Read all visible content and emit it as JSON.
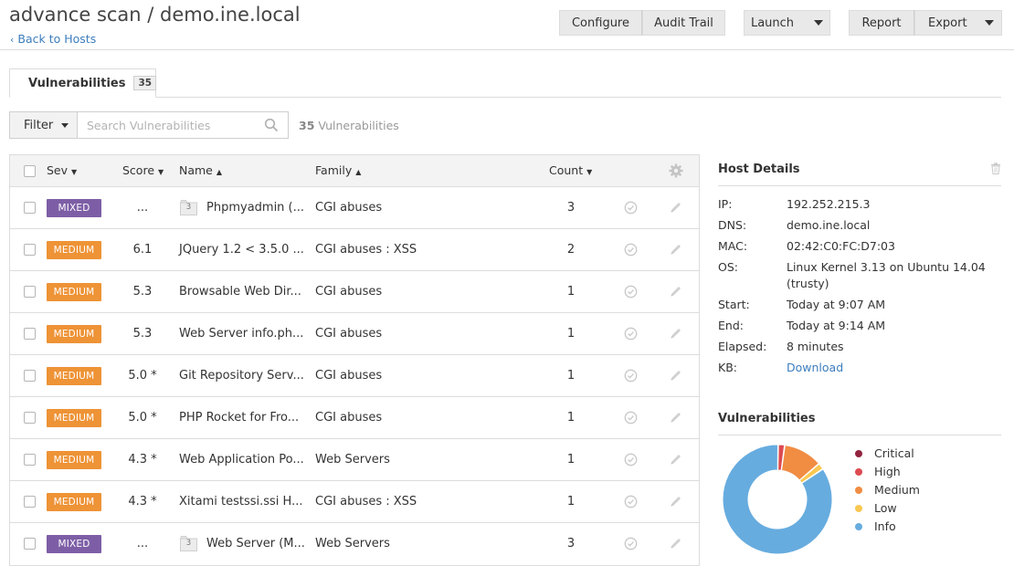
{
  "header": {
    "title": "advance scan / demo.ine.local",
    "back_link": "Back to Hosts"
  },
  "toolbar": {
    "configure_label": "Configure",
    "audit_trail_label": "Audit Trail",
    "launch_label": "Launch",
    "report_label": "Report",
    "export_label": "Export"
  },
  "tabs": [
    {
      "label": "Vulnerabilities",
      "count": "35"
    }
  ],
  "filter": {
    "filter_label": "Filter",
    "search_placeholder": "Search Vulnerabilities",
    "result_count": "35",
    "result_text": " Vulnerabilities"
  },
  "table": {
    "columns": {
      "sev": "Sev",
      "score": "Score",
      "name": "Name",
      "family": "Family",
      "count": "Count"
    },
    "rows": [
      {
        "sev": "MIXED",
        "score": "...",
        "name": "Phpmyadmin (...",
        "family": "CGI abuses",
        "count": "3",
        "grouped": true,
        "group_count": "3"
      },
      {
        "sev": "MEDIUM",
        "score": "6.1",
        "name": "JQuery 1.2 < 3.5.0 ...",
        "family": "CGI abuses : XSS",
        "count": "2",
        "grouped": false
      },
      {
        "sev": "MEDIUM",
        "score": "5.3",
        "name": "Browsable Web Dir...",
        "family": "CGI abuses",
        "count": "1",
        "grouped": false
      },
      {
        "sev": "MEDIUM",
        "score": "5.3",
        "name": "Web Server info.ph...",
        "family": "CGI abuses",
        "count": "1",
        "grouped": false
      },
      {
        "sev": "MEDIUM",
        "score": "5.0 *",
        "name": "Git Repository Serv...",
        "family": "CGI abuses",
        "count": "1",
        "grouped": false
      },
      {
        "sev": "MEDIUM",
        "score": "5.0 *",
        "name": "PHP Rocket for Fro...",
        "family": "CGI abuses",
        "count": "1",
        "grouped": false
      },
      {
        "sev": "MEDIUM",
        "score": "4.3 *",
        "name": "Web Application Po...",
        "family": "Web Servers",
        "count": "1",
        "grouped": false
      },
      {
        "sev": "MEDIUM",
        "score": "4.3 *",
        "name": "Xitami testssi.ssi H...",
        "family": "CGI abuses : XSS",
        "count": "1",
        "grouped": false
      },
      {
        "sev": "MIXED",
        "score": "...",
        "name": "Web Server (M...",
        "family": "Web Servers",
        "count": "3",
        "grouped": true,
        "group_count": "3"
      }
    ]
  },
  "host_details": {
    "title": "Host Details",
    "items": [
      {
        "label": "IP:",
        "value": "192.252.215.3"
      },
      {
        "label": "DNS:",
        "value": "demo.ine.local"
      },
      {
        "label": "MAC:",
        "value": "02:42:C0:FC:D7:03"
      },
      {
        "label": "OS:",
        "value": "Linux Kernel 3.13 on Ubuntu 14.04 (trusty)"
      },
      {
        "label": "Start:",
        "value": "Today at 9:07 AM"
      },
      {
        "label": "End:",
        "value": "Today at 9:14 AM"
      },
      {
        "label": "Elapsed:",
        "value": "8 minutes"
      },
      {
        "label": "KB:",
        "value": "Download",
        "link": true
      }
    ]
  },
  "vuln_chart": {
    "title": "Vulnerabilities",
    "legend": [
      "Critical",
      "High",
      "Medium",
      "Low",
      "Info"
    ]
  },
  "colors": {
    "mixed": "#7d5ea6",
    "medium": "#ee9336",
    "critical": "#91243e",
    "high": "#dd4b50",
    "medium_chart": "#f18c43",
    "low": "#f8c851",
    "info": "#67acdf",
    "link": "#3c7dbd"
  },
  "chart_data": {
    "type": "pie",
    "categories": [
      "Critical",
      "High",
      "Medium",
      "Low",
      "Info"
    ],
    "values": [
      0,
      2,
      12,
      2,
      88
    ]
  }
}
